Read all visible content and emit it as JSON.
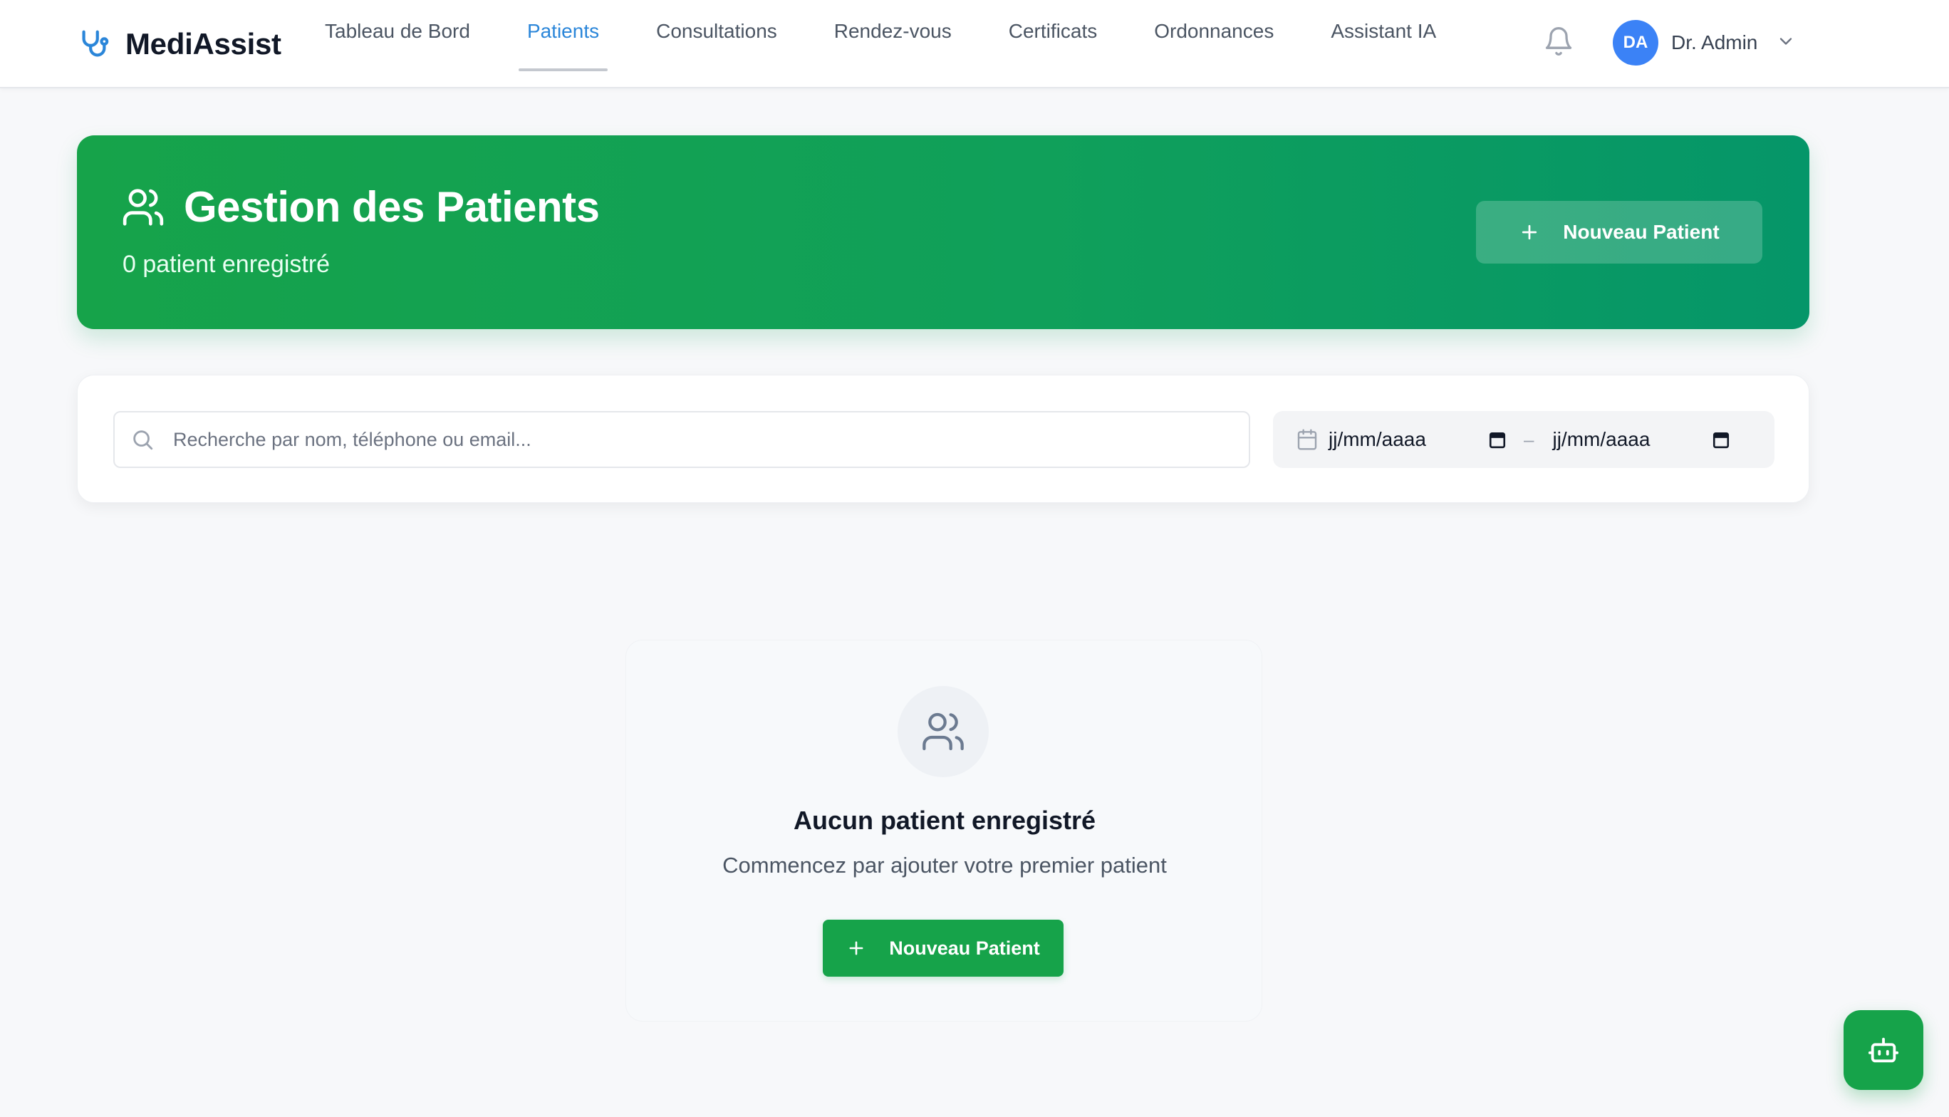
{
  "colors": {
    "brand": "#2b86d9",
    "primary_green": "#16a34a",
    "hero_gradient_end": "#059669",
    "avatar": "#3b82f6"
  },
  "header": {
    "brand_name": "MediAssist",
    "brand_icon": "stethoscope-icon",
    "nav": [
      {
        "label": "Tableau de Bord",
        "active": false
      },
      {
        "label": "Patients",
        "active": true
      },
      {
        "label": "Consultations",
        "active": false
      },
      {
        "label": "Rendez-vous",
        "active": false
      },
      {
        "label": "Certificats",
        "active": false
      },
      {
        "label": "Ordonnances",
        "active": false
      },
      {
        "label": "Assistant IA",
        "active": false
      }
    ],
    "notifications_icon": "bell-icon",
    "user": {
      "initials": "DA",
      "name": "Dr. Admin",
      "menu_icon": "chevron-down-icon"
    }
  },
  "hero": {
    "icon": "users-icon",
    "title": "Gestion des Patients",
    "subtitle": "0 patient enregistré",
    "new_button_label": "Nouveau Patient"
  },
  "filters": {
    "search_placeholder": "Recherche par nom, téléphone ou email...",
    "date_from": "jj/mm/aaaa",
    "date_to": "jj/mm/aaaa",
    "separator": "–"
  },
  "empty_state": {
    "icon": "users-icon",
    "title": "Aucun patient enregistré",
    "subtitle": "Commencez par ajouter votre premier patient",
    "button_label": "Nouveau Patient"
  },
  "fab": {
    "icon": "robot-icon"
  }
}
